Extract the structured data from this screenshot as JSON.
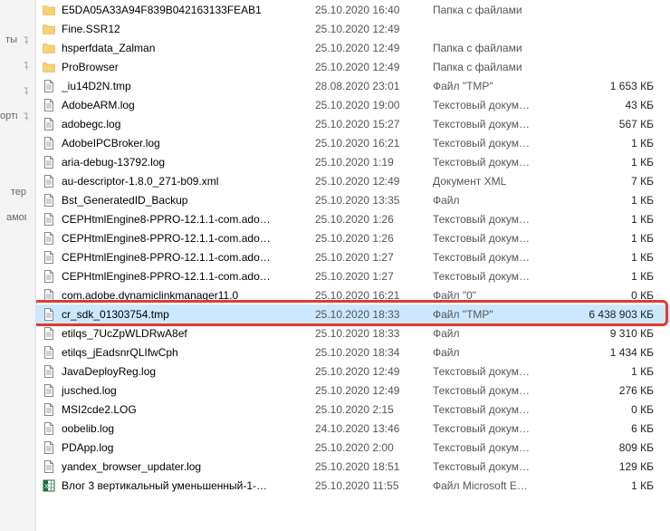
{
  "sidebar": {
    "items": [
      {
        "label": "",
        "pin": false
      },
      {
        "label": "ты",
        "pin": true
      },
      {
        "label": "",
        "pin": true
      },
      {
        "label": "",
        "pin": true
      },
      {
        "label": "орти",
        "pin": true
      },
      {
        "label": "",
        "pin": false
      },
      {
        "label": "",
        "pin": false
      },
      {
        "label": "тер",
        "pin": false
      },
      {
        "label": "амовС.",
        "pin": false
      }
    ]
  },
  "files": [
    {
      "icon": "folder",
      "name": "E5DA05A33A94F839B042163133FEAB1",
      "date": "25.10.2020 16:40",
      "type": "Папка с файлами",
      "size": ""
    },
    {
      "icon": "folder",
      "name": "Fine.SSR12",
      "date": "25.10.2020 12:49",
      "type": "",
      "size": ""
    },
    {
      "icon": "folder",
      "name": "hsperfdata_Zalman",
      "date": "25.10.2020 12:49",
      "type": "Папка с файлами",
      "size": ""
    },
    {
      "icon": "folder",
      "name": "ProBrowser",
      "date": "25.10.2020 12:49",
      "type": "Папка с файлами",
      "size": ""
    },
    {
      "icon": "doc",
      "name": "_iu14D2N.tmp",
      "date": "28.08.2020 23:01",
      "type": "Файл \"TMP\"",
      "size": "1 653 КБ"
    },
    {
      "icon": "doc",
      "name": "AdobeARM.log",
      "date": "25.10.2020 19:00",
      "type": "Текстовый докум…",
      "size": "43 КБ"
    },
    {
      "icon": "doc",
      "name": "adobegc.log",
      "date": "25.10.2020 15:27",
      "type": "Текстовый докум…",
      "size": "567 КБ"
    },
    {
      "icon": "doc",
      "name": "AdobeIPCBroker.log",
      "date": "25.10.2020 16:21",
      "type": "Текстовый докум…",
      "size": "1 КБ"
    },
    {
      "icon": "doc",
      "name": "aria-debug-13792.log",
      "date": "25.10.2020 1:19",
      "type": "Текстовый докум…",
      "size": "1 КБ"
    },
    {
      "icon": "doc",
      "name": "au-descriptor-1.8.0_271-b09.xml",
      "date": "25.10.2020 12:49",
      "type": "Документ XML",
      "size": "7 КБ"
    },
    {
      "icon": "doc",
      "name": "Bst_GeneratedID_Backup",
      "date": "25.10.2020 13:35",
      "type": "Файл",
      "size": "1 КБ"
    },
    {
      "icon": "doc",
      "name": "CEPHtmlEngine8-PPRO-12.1.1-com.ado…",
      "date": "25.10.2020 1:26",
      "type": "Текстовый докум…",
      "size": "1 КБ"
    },
    {
      "icon": "doc",
      "name": "CEPHtmlEngine8-PPRO-12.1.1-com.ado…",
      "date": "25.10.2020 1:26",
      "type": "Текстовый докум…",
      "size": "1 КБ"
    },
    {
      "icon": "doc",
      "name": "CEPHtmlEngine8-PPRO-12.1.1-com.ado…",
      "date": "25.10.2020 1:27",
      "type": "Текстовый докум…",
      "size": "1 КБ"
    },
    {
      "icon": "doc",
      "name": "CEPHtmlEngine8-PPRO-12.1.1-com.ado…",
      "date": "25.10.2020 1:27",
      "type": "Текстовый докум…",
      "size": "1 КБ"
    },
    {
      "icon": "doc",
      "name": "com.adobe.dynamiclinkmanager11.0",
      "date": "25.10.2020 16:21",
      "type": "Файл \"0\"",
      "size": "0 КБ"
    },
    {
      "icon": "doc",
      "name": "cr_sdk_01303754.tmp",
      "date": "25.10.2020 18:33",
      "type": "Файл \"TMP\"",
      "size": "6 438 903 КБ",
      "selected": true,
      "highlight": true
    },
    {
      "icon": "doc",
      "name": "etilqs_7UcZpWLDRwA8ef",
      "date": "25.10.2020 18:33",
      "type": "Файл",
      "size": "9 310 КБ"
    },
    {
      "icon": "doc",
      "name": "etilqs_jEadsnrQLIfwCph",
      "date": "25.10.2020 18:34",
      "type": "Файл",
      "size": "1 434 КБ"
    },
    {
      "icon": "doc",
      "name": "JavaDeployReg.log",
      "date": "25.10.2020 12:49",
      "type": "Текстовый докум…",
      "size": "1 КБ"
    },
    {
      "icon": "doc",
      "name": "jusched.log",
      "date": "25.10.2020 12:49",
      "type": "Текстовый докум…",
      "size": "276 КБ"
    },
    {
      "icon": "doc",
      "name": "MSI2cde2.LOG",
      "date": "25.10.2020 2:15",
      "type": "Текстовый докум…",
      "size": "0 КБ"
    },
    {
      "icon": "doc",
      "name": "oobelib.log",
      "date": "24.10.2020 13:46",
      "type": "Текстовый докум…",
      "size": "6 КБ"
    },
    {
      "icon": "doc",
      "name": "PDApp.log",
      "date": "25.10.2020 2:00",
      "type": "Текстовый докум…",
      "size": "809 КБ"
    },
    {
      "icon": "doc",
      "name": "yandex_browser_updater.log",
      "date": "25.10.2020 18:51",
      "type": "Текстовый докум…",
      "size": "129 КБ"
    },
    {
      "icon": "xls",
      "name": "Влог 3 вертикальный уменьшенный-1-…",
      "date": "25.10.2020 11:55",
      "type": "Файл Microsoft E…",
      "size": "1 КБ"
    }
  ]
}
